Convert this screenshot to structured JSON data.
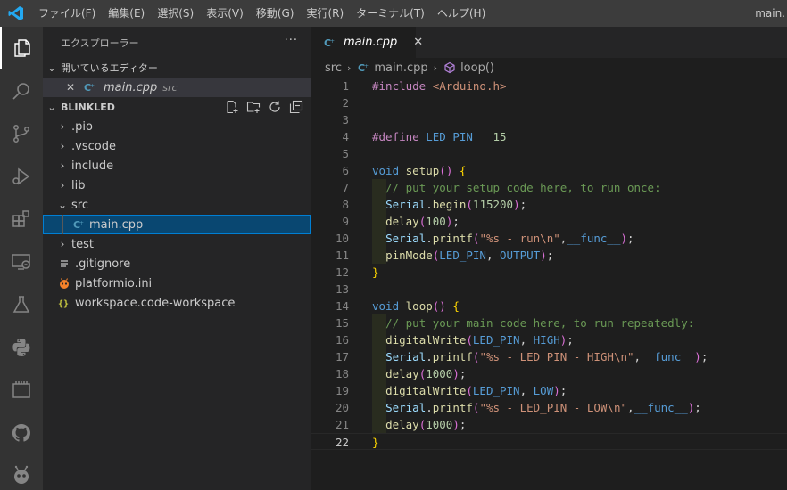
{
  "titlebar": {
    "menu": [
      "ファイル(F)",
      "編集(E)",
      "選択(S)",
      "表示(V)",
      "移動(G)",
      "実行(R)",
      "ターミナル(T)",
      "ヘルプ(H)"
    ],
    "title": "main."
  },
  "activity_icons": [
    "explorer-icon",
    "search-icon",
    "source-control-icon",
    "run-debug-icon",
    "extensions-icon",
    "remote-explorer-icon",
    "testing-icon",
    "python-icon",
    "project-icon",
    "github-icon",
    "platformio-icon"
  ],
  "sidebar": {
    "title": "エクスプローラー",
    "more": "···",
    "open_editors": {
      "label": "開いているエディター",
      "items": [
        {
          "name": "main.cpp",
          "path": "src"
        }
      ]
    },
    "workspace": {
      "label": "BLINKLED",
      "tree": [
        {
          "name": ".pio",
          "kind": "folder",
          "expanded": false
        },
        {
          "name": ".vscode",
          "kind": "folder",
          "expanded": false
        },
        {
          "name": "include",
          "kind": "folder",
          "expanded": false
        },
        {
          "name": "lib",
          "kind": "folder",
          "expanded": false
        },
        {
          "name": "src",
          "kind": "folder",
          "expanded": true
        },
        {
          "name": "main.cpp",
          "kind": "cpp",
          "selected": true
        },
        {
          "name": "test",
          "kind": "folder",
          "expanded": false
        },
        {
          "name": ".gitignore",
          "kind": "text"
        },
        {
          "name": "platformio.ini",
          "kind": "platformio"
        },
        {
          "name": "workspace.code-workspace",
          "kind": "json"
        }
      ]
    }
  },
  "editor": {
    "tab": "main.cpp",
    "breadcrumb": [
      "src",
      "main.cpp",
      "loop()"
    ],
    "current_line": 22,
    "lines": [
      "#include <Arduino.h>",
      "",
      "",
      "#define LED_PIN   15",
      "",
      "void setup() {",
      "  // put your setup code here, to run once:",
      "  Serial.begin(115200);",
      "  delay(100);",
      "  Serial.printf(\"%s - run\\n\",__func__);",
      "  pinMode(LED_PIN, OUTPUT);",
      "}",
      "",
      "void loop() {",
      "  // put your main code here, to run repeatedly:",
      "  digitalWrite(LED_PIN, HIGH);",
      "  Serial.printf(\"%s - LED_PIN - HIGH\\n\",__func__);",
      "  delay(1000);",
      "  digitalWrite(LED_PIN, LOW);",
      "  Serial.printf(\"%s - LED_PIN - LOW\\n\",__func__);",
      "  delay(1000);",
      "}"
    ]
  },
  "colors": {
    "accent": "#007acc",
    "selection": "#094771",
    "keyword": "#c586c0",
    "type": "#569cd6",
    "function": "#dcdcaa",
    "variable": "#9cdcfe",
    "string": "#ce9178",
    "number": "#b5cea8",
    "comment": "#6a9955"
  }
}
